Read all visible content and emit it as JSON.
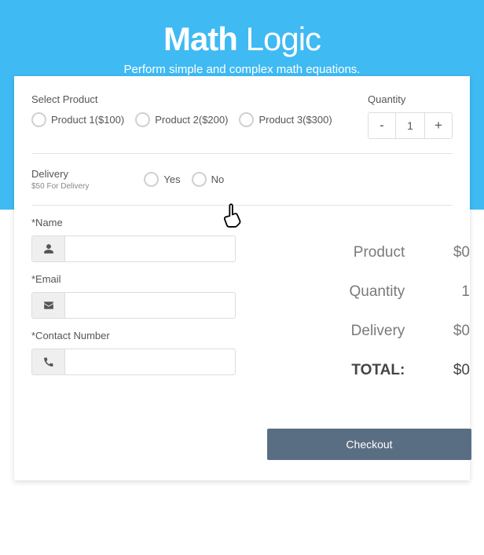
{
  "hero": {
    "title_bold": "Math",
    "title_light": "Logic",
    "subtitle": "Perform simple and complex math equations."
  },
  "product": {
    "label": "Select Product",
    "options": [
      {
        "label": "Product 1($100)"
      },
      {
        "label": "Product 2($200)"
      },
      {
        "label": "Product 3($300)"
      }
    ]
  },
  "quantity": {
    "label": "Quantity",
    "minus": "-",
    "plus": "+",
    "value": "1"
  },
  "delivery": {
    "label": "Delivery",
    "sub": "$50 For Delivery",
    "yes": "Yes",
    "no": "No"
  },
  "form": {
    "name": {
      "label": "*Name"
    },
    "email": {
      "label": "*Email"
    },
    "contact": {
      "label": "*Contact Number"
    }
  },
  "summary": {
    "product": {
      "label": "Product",
      "value": "$0"
    },
    "quantity": {
      "label": "Quantity",
      "value": "1"
    },
    "delivery": {
      "label": "Delivery",
      "value": "$0"
    },
    "total": {
      "label": "TOTAL:",
      "value": "$0"
    }
  },
  "checkout": "Checkout"
}
